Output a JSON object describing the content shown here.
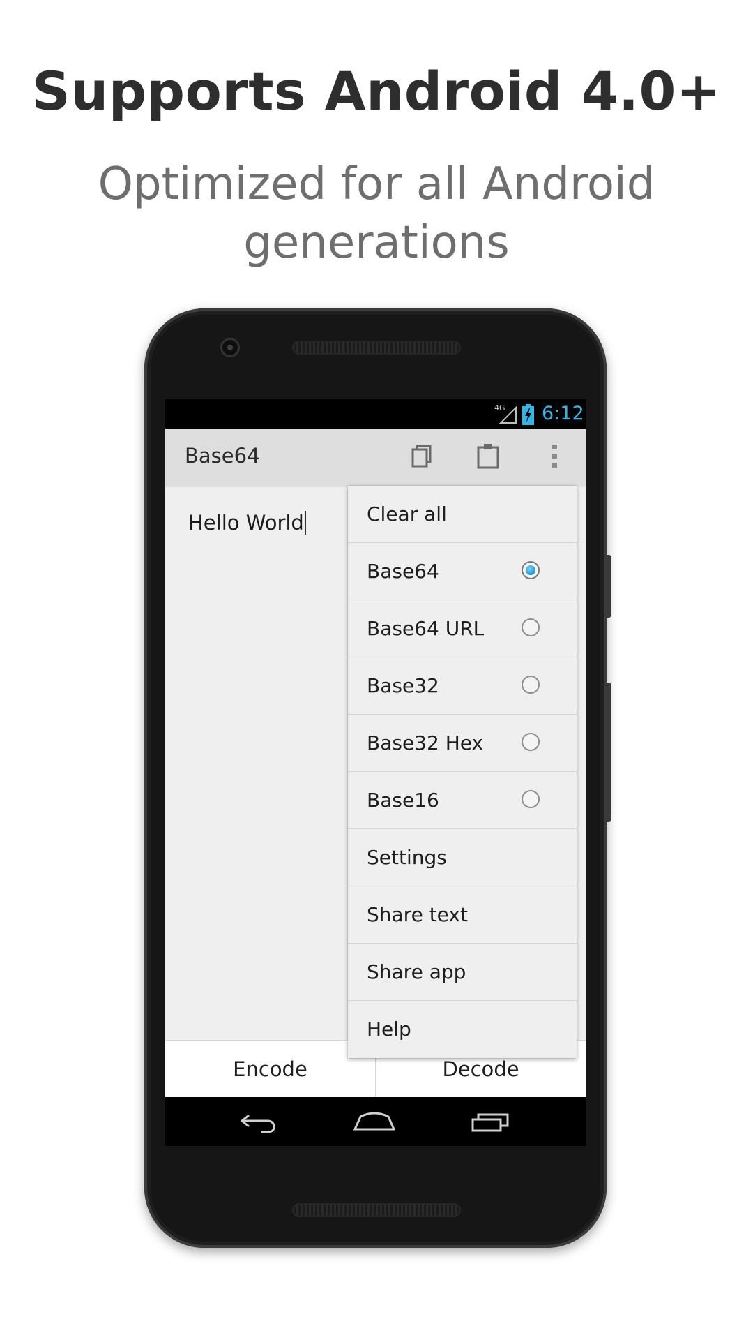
{
  "headline": "Supports Android 4.0+",
  "subheadline": "Optimized for all Android generations",
  "status_bar": {
    "network": "4G",
    "time": "6:12",
    "clock_color": "#33b5e5"
  },
  "action_bar": {
    "title": "Base64",
    "icons": [
      "copy-icon",
      "paste-icon",
      "overflow-menu-icon"
    ]
  },
  "editor": {
    "text": "Hello World"
  },
  "menu": {
    "items": [
      {
        "label": "Clear all"
      },
      {
        "label": "Base64",
        "radio": true,
        "checked": true
      },
      {
        "label": "Base64 URL",
        "radio": true,
        "checked": false
      },
      {
        "label": "Base32",
        "radio": true,
        "checked": false
      },
      {
        "label": "Base32 Hex",
        "radio": true,
        "checked": false
      },
      {
        "label": "Base16",
        "radio": true,
        "checked": false
      },
      {
        "label": "Settings"
      },
      {
        "label": "Share text"
      },
      {
        "label": "Share app"
      },
      {
        "label": "Help"
      }
    ]
  },
  "buttons": {
    "encode": "Encode",
    "decode": "Decode"
  },
  "navigation": {
    "icons": [
      "back-icon",
      "home-icon",
      "recents-icon"
    ]
  },
  "colors": {
    "accent": "#33b5e5",
    "radio_checked": "#1a9bd6"
  }
}
